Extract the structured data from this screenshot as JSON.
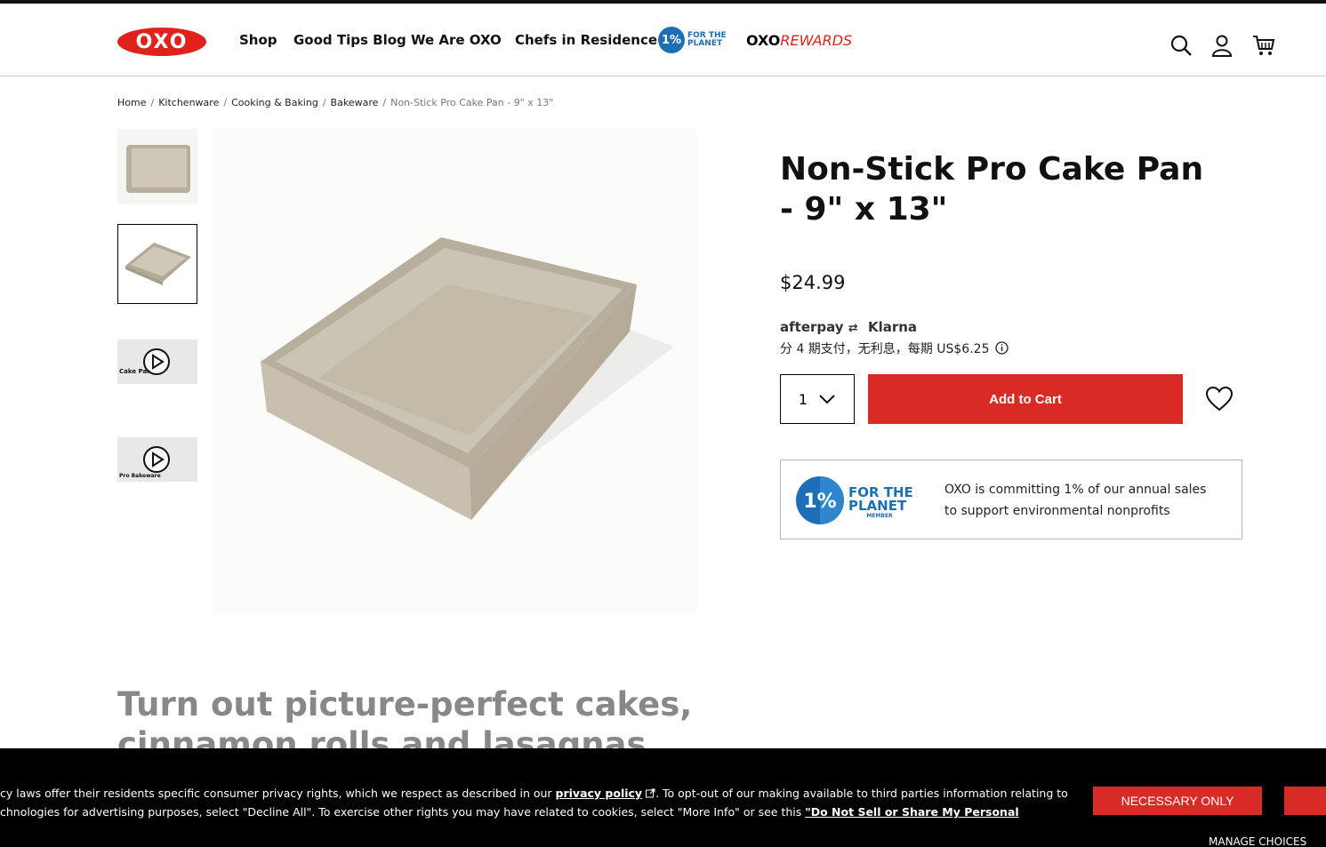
{
  "header": {
    "logo_text": "OXO",
    "nav": [
      "Shop",
      "Good Tips Blog",
      "We Are OXO",
      "Chefs in Residence"
    ],
    "planet_badge": {
      "number": "1%",
      "line1": "FOR THE",
      "line2": "PLANET"
    },
    "rewards": {
      "brand": "OXO",
      "suffix": "REWARDS"
    }
  },
  "breadcrumb": [
    "Home",
    "Kitchenware",
    "Cooking & Baking",
    "Bakeware",
    "Non-Stick Pro Cake Pan - 9\" x 13\""
  ],
  "product": {
    "title": "Non-Stick Pro Cake Pan - 9\" x 13\"",
    "price": "$24.99",
    "afterpay": "afterpay",
    "klarna": "Klarna",
    "installments": "分 4 期支付，无利息，每期 US$6.25",
    "quantity": "1",
    "add_to_cart": "Add to Cart"
  },
  "planet_box": {
    "logo_line1": "FOR THE",
    "logo_line2": "PLANET",
    "logo_sub": "MEMBER",
    "text": "OXO is committing 1% of our annual sales to support environmental nonprofits"
  },
  "thumbnails": {
    "video1_caption": "Cake Pan",
    "video2_caption": "Pro Bakeware"
  },
  "section_headline": {
    "line1": "Turn out picture-perfect cakes,",
    "line2": "cinnamon rolls and lasagnas"
  },
  "cookie": {
    "text1_pre": "cy laws offer their residents specific consumer privacy rights, which we respect as described in our ",
    "privacy_link": "privacy policy",
    "text1_post": ". To opt-out of our making available to third parties information relating to",
    "text2_pre": "chnologies for advertising purposes, select \"Decline All\". To exercise other rights you may have related to cookies, select \"More Info\" or see this ",
    "dns_link": "\"Do Not Sell or Share My Personal",
    "necessary_button": "NECESSARY ONLY",
    "manage_choices": "MANAGE CHOICES"
  },
  "colors": {
    "brand_red": "#e1221c",
    "button_red": "#d92b25",
    "planet_blue": "#1c6fb5"
  }
}
